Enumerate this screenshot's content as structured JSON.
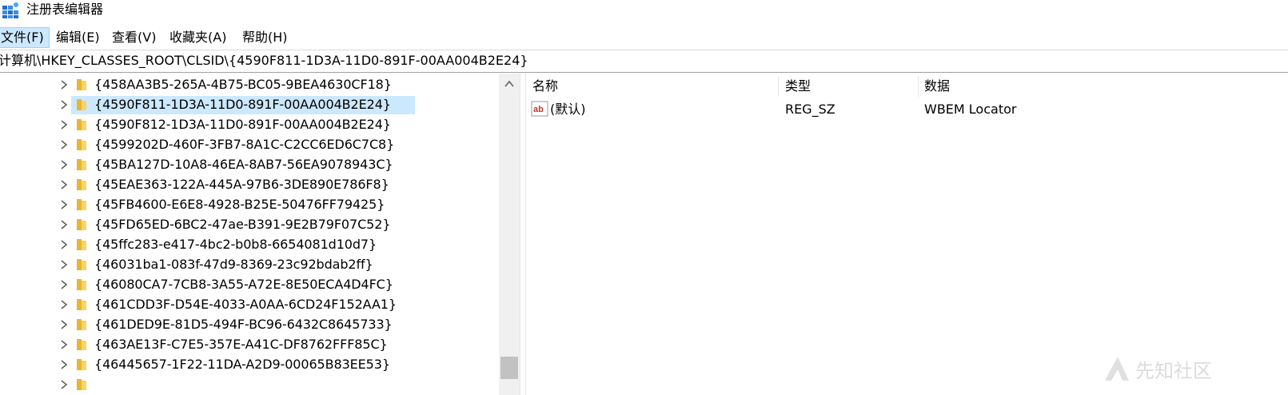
{
  "window": {
    "title": "注册表编辑器",
    "icon": "regedit-icon"
  },
  "menu": {
    "items": [
      {
        "label": "文件(F)"
      },
      {
        "label": "编辑(E)"
      },
      {
        "label": "查看(V)"
      },
      {
        "label": "收藏夹(A)"
      },
      {
        "label": "帮助(H)"
      }
    ]
  },
  "address": {
    "path": "计算机\\HKEY_CLASSES_ROOT\\CLSID\\{4590F811-1D3A-11D0-891F-00AA004B2E24}"
  },
  "tree": {
    "items": [
      {
        "label": "{458AA3B5-265A-4B75-BC05-9BEA4630CF18}"
      },
      {
        "label": "{4590F811-1D3A-11D0-891F-00AA004B2E24}",
        "selected": true
      },
      {
        "label": "{4590F812-1D3A-11D0-891F-00AA004B2E24}"
      },
      {
        "label": "{4599202D-460F-3FB7-8A1C-C2CC6ED6C7C8}"
      },
      {
        "label": "{45BA127D-10A8-46EA-8AB7-56EA9078943C}"
      },
      {
        "label": "{45EAE363-122A-445A-97B6-3DE890E786F8}"
      },
      {
        "label": "{45FB4600-E6E8-4928-B25E-50476FF79425}"
      },
      {
        "label": "{45FD65ED-6BC2-47ae-B391-9E2B79F07C52}"
      },
      {
        "label": "{45ffc283-e417-4bc2-b0b8-6654081d10d7}"
      },
      {
        "label": "{46031ba1-083f-47d9-8369-23c92bdab2ff}"
      },
      {
        "label": "{46080CA7-7CB8-3A55-A72E-8E50ECA4D4FC}"
      },
      {
        "label": "{461CDD3F-D54E-4033-A0AA-6CD24F152AA1}"
      },
      {
        "label": "{461DED9E-81D5-494F-BC96-6432C8645733}"
      },
      {
        "label": "{463AE13F-C7E5-357E-A41C-DF8762FFF85C}"
      },
      {
        "label": "{46445657-1F22-11DA-A2D9-00065B83EE53}"
      }
    ],
    "expand_icon": "chevron-right-icon",
    "folder_icon": "folder-icon",
    "folder_color": "#e8b730"
  },
  "values_list": {
    "columns": [
      {
        "label": "名称"
      },
      {
        "label": "类型"
      },
      {
        "label": "数据"
      }
    ],
    "rows": [
      {
        "name": "(默认)",
        "type": "REG_SZ",
        "data": "WBEM Locator",
        "icon": "string-value-icon"
      }
    ]
  },
  "colors": {
    "selection": "#cce8ff",
    "menu_active_border": "#99d1ff",
    "value_icon_red": "#c0392b"
  },
  "watermark": {
    "text": "先知社区"
  }
}
